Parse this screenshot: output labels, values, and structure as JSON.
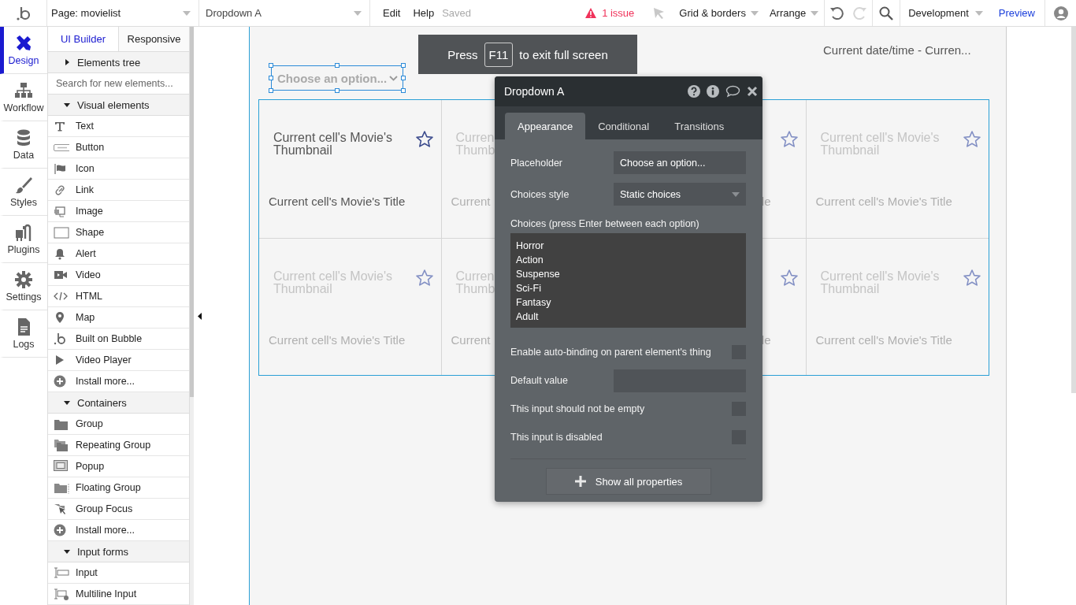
{
  "topbar": {
    "page_select": "Page: movielist",
    "element_select": "Dropdown A",
    "menu": [
      "Edit",
      "Help"
    ],
    "save_status": "Saved",
    "issues": "1 issue",
    "grid_menu": "Grid & borders",
    "arrange_menu": "Arrange",
    "history": [
      {
        "kind": "undo",
        "disabled": false
      },
      {
        "kind": "redo",
        "disabled": true
      }
    ],
    "environment": "Development",
    "preview": "Preview"
  },
  "rail": [
    {
      "label": "Design",
      "selected": true
    },
    {
      "label": "Workflow",
      "selected": false
    },
    {
      "label": "Data",
      "selected": false
    },
    {
      "label": "Styles",
      "selected": false
    },
    {
      "label": "Plugins",
      "selected": false
    },
    {
      "label": "Settings",
      "selected": false
    },
    {
      "label": "Logs",
      "selected": false
    }
  ],
  "palette": {
    "tabs": [
      {
        "label": "UI Builder",
        "selected": true
      },
      {
        "label": "Responsive",
        "selected": false
      }
    ],
    "tree": {
      "label": "Elements tree",
      "expanded": false
    },
    "search": {
      "placeholder": "Search for new elements..."
    },
    "sections": [
      {
        "title": "Visual elements",
        "expanded": true,
        "items": [
          "Text",
          "Button",
          "Icon",
          "Link",
          "Image",
          "Shape",
          "Alert",
          "Video",
          "HTML",
          "Map",
          "Built on Bubble",
          "Video Player",
          "Install more..."
        ]
      },
      {
        "title": "Containers",
        "expanded": true,
        "items": [
          "Group",
          "Repeating Group",
          "Popup",
          "Floating Group",
          "Group Focus",
          "Install more..."
        ]
      },
      {
        "title": "Input forms",
        "expanded": true,
        "items": [
          "Input",
          "Multiline Input"
        ]
      }
    ]
  },
  "canvas": {
    "banner": {
      "before": "Press",
      "key": "F11",
      "after": "to exit full screen"
    },
    "date_text": "Current date/time - Curren...",
    "dropdown": {
      "placeholder": "Choose an option...",
      "selected": true
    },
    "repeating_group": {
      "rows": [
        {
          "cells": [
            {
              "kind": "full",
              "thumbnail_lines": [
                "Current cell's Movie's",
                "Thumbnail"
              ],
              "title": "Current cell's Movie's Title",
              "dimmed": false
            },
            {
              "kind": "cut_right",
              "thumbnail_lines": [
                "Curren",
                "Thumb"
              ],
              "title": "Current",
              "dimmed": true
            },
            {
              "kind": "cut_left",
              "title": "le",
              "dimmed": true
            },
            {
              "kind": "full",
              "thumbnail_lines": [
                "Current cell's Movie's",
                "Thumbnail"
              ],
              "title": "Current cell's Movie's Title",
              "dimmed": true
            }
          ]
        },
        {
          "cells": [
            {
              "kind": "full",
              "thumbnail_lines": [
                "Current cell's Movie's",
                "Thumbnail"
              ],
              "title": "Current cell's Movie's Title",
              "dimmed": true
            },
            {
              "kind": "cut_right",
              "thumbnail_lines": [
                "Curren",
                "Thumb"
              ],
              "title": "Current",
              "dimmed": true
            },
            {
              "kind": "cut_left",
              "title": "le",
              "dimmed": true
            },
            {
              "kind": "full",
              "thumbnail_lines": [
                "Current cell's Movie's",
                "Thumbnail"
              ],
              "title": "Current cell's Movie's Title",
              "dimmed": true
            }
          ]
        }
      ]
    }
  },
  "editor": {
    "title": "Dropdown A",
    "tabs": [
      {
        "label": "Appearance",
        "selected": true
      },
      {
        "label": "Conditional",
        "selected": false
      },
      {
        "label": "Transitions",
        "selected": false
      }
    ],
    "properties": [
      {
        "kind": "field",
        "label": "Placeholder",
        "value": "Choose an option..."
      },
      {
        "kind": "select",
        "label": "Choices style",
        "value": "Static choices"
      },
      {
        "kind": "textarea",
        "label": "Choices (press Enter between each option)",
        "lines": [
          "Horror",
          "Action",
          "Suspense",
          "Sci-Fi",
          "Fantasy",
          "Adult"
        ]
      },
      {
        "kind": "checkbox",
        "label": "Enable auto-binding on parent element's thing",
        "checked": false
      },
      {
        "kind": "field",
        "label": "Default value"
      },
      {
        "kind": "checkbox",
        "label": "This input should not be empty",
        "checked": false
      },
      {
        "kind": "checkbox",
        "label": "This input is disabled",
        "checked": false
      }
    ],
    "footer_button": "Show all properties"
  }
}
